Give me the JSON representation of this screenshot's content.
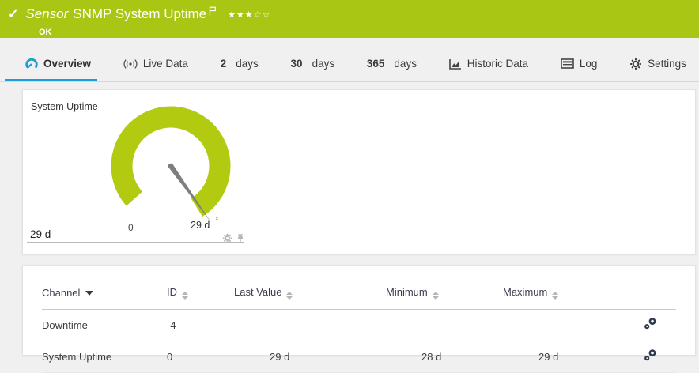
{
  "header": {
    "check_glyph": "✓",
    "kind": "Sensor",
    "title": "SNMP System Uptime",
    "status": "OK",
    "stars_filled": "★★★",
    "stars_empty": "☆☆",
    "bg_color": "#aac614",
    "text_color": "#ffffff"
  },
  "tabs": {
    "accent_color": "#1b9dd9",
    "items": [
      {
        "label": "Overview",
        "icon": "gauge-icon",
        "active": true
      },
      {
        "label": "Live Data",
        "icon": "broadcast-icon",
        "active": false
      },
      {
        "number": "2",
        "unit": "days",
        "active": false
      },
      {
        "number": "30",
        "unit": "days",
        "active": false
      },
      {
        "number": "365",
        "unit": "days",
        "active": false
      },
      {
        "label": "Historic Data",
        "icon": "historic-chart-icon",
        "active": false
      },
      {
        "label": "Log",
        "icon": "log-icon",
        "active": false
      },
      {
        "label": "Settings",
        "icon": "gear-icon",
        "active": false
      }
    ]
  },
  "gauge_panel": {
    "title": "System Uptime",
    "scale_min_label": "0",
    "scale_max_label": "29 d",
    "current_value_label": "29 d",
    "pointer_marker": "x",
    "ring_color": "#b2ca10",
    "needle_color": "#7e7e7e",
    "footer_icons": [
      "gear-icon",
      "pin-icon"
    ]
  },
  "chart_data": {
    "type": "gauge",
    "title": "System Uptime",
    "min_label": "0",
    "max_label": "29 d",
    "value": "29 d"
  },
  "channels_table": {
    "headers": [
      {
        "label": "Channel",
        "sort": "sorted-desc"
      },
      {
        "label": "ID",
        "sort": "sortable"
      },
      {
        "label": "Last Value",
        "sort": "sortable"
      },
      {
        "label": "Minimum",
        "sort": "sortable"
      },
      {
        "label": "Maximum",
        "sort": "sortable"
      }
    ],
    "rows": [
      {
        "channel": "Downtime",
        "id": "-4",
        "last_value": "",
        "minimum": "",
        "maximum": "",
        "action_icon": "channel-gears-icon"
      },
      {
        "channel": "System Uptime",
        "id": "0",
        "last_value": "29 d",
        "minimum": "28 d",
        "maximum": "29 d",
        "action_icon": "channel-gears-icon"
      }
    ]
  }
}
